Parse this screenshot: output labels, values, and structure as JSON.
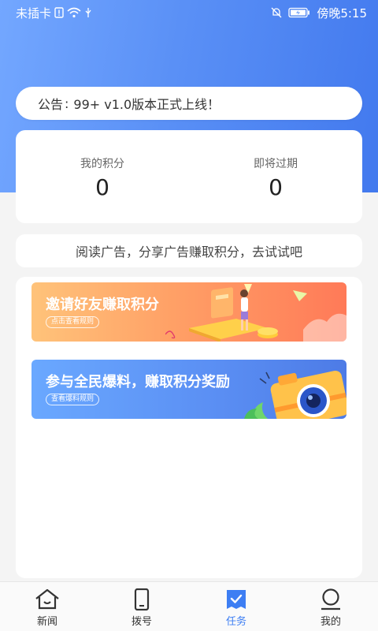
{
  "status_bar": {
    "carrier": "未插卡",
    "time": "傍晚5:15"
  },
  "notice": {
    "label": "公告",
    "separator": ":",
    "text": "99+ v1.0版本正式上线！"
  },
  "points": {
    "my_points_label": "我的积分",
    "my_points_value": "0",
    "expiring_label": "即将过期",
    "expiring_value": "0"
  },
  "tip": {
    "text": "阅读广告，分享广告赚取积分，去试试吧"
  },
  "tasks": [
    {
      "title": "邀请好友赚取积分",
      "sub": "点击查看规则"
    },
    {
      "title": "参与全民爆料，赚取积分奖励",
      "sub": "查看爆料规则"
    }
  ],
  "tabbar": {
    "items": [
      {
        "label": "新闻",
        "icon": "home-icon",
        "active": false
      },
      {
        "label": "拨号",
        "icon": "phone-icon",
        "active": false
      },
      {
        "label": "任务",
        "icon": "task-icon",
        "active": true
      },
      {
        "label": "我的",
        "icon": "profile-icon",
        "active": false
      }
    ]
  },
  "colors": {
    "header_gradient_start": "#73a7ff",
    "header_gradient_end": "#4279ee",
    "active_tab": "#3d7ef3",
    "banner_orange": "#ff8a5c",
    "banner_blue": "#5a8ef3"
  }
}
